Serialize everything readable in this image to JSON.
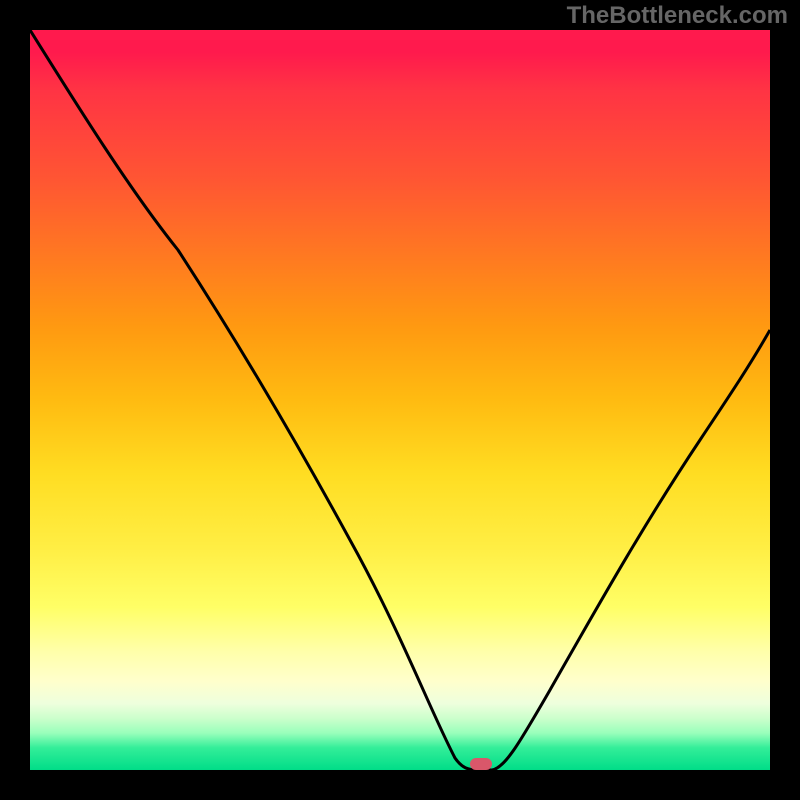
{
  "watermark": "TheBottleneck.com",
  "chart_data": {
    "type": "line",
    "title": "",
    "xlabel": "",
    "ylabel": "",
    "xlim": [
      0,
      100
    ],
    "ylim": [
      0,
      100
    ],
    "grid": false,
    "background": "vertical-gradient (red at top through orange/yellow to green at bottom, representing bottleneck severity)",
    "series": [
      {
        "name": "bottleneck-curve",
        "color": "#000000",
        "x": [
          0,
          10,
          20,
          30,
          40,
          50,
          55,
          58,
          60,
          62,
          65,
          70,
          80,
          90,
          100
        ],
        "y": [
          100,
          88,
          76,
          62,
          45,
          26,
          14,
          4,
          0,
          0,
          5,
          15,
          32,
          48,
          60
        ],
        "note": "V-shaped curve with minimum (optimal point) near x≈60; left branch steeper than right, with slight change in slope around x≈20"
      }
    ],
    "marker": {
      "name": "optimal-point",
      "x": 61,
      "y": 0,
      "color": "#d9576a",
      "shape": "rounded-rect"
    }
  }
}
